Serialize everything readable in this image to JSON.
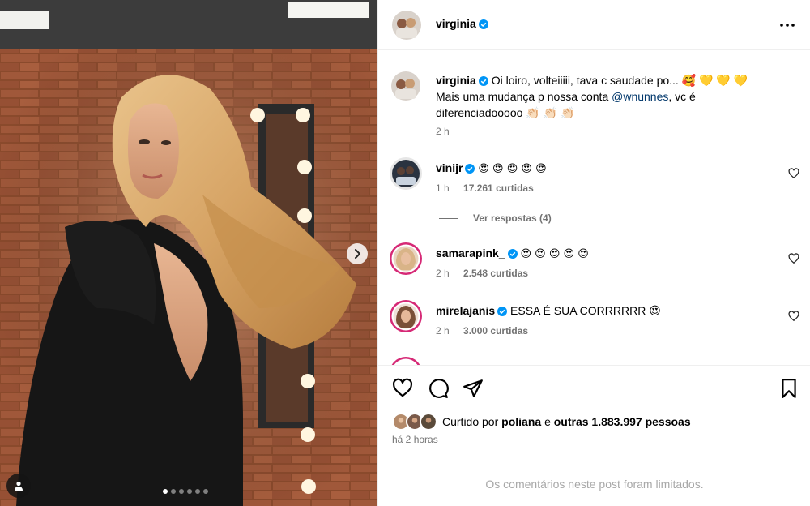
{
  "post": {
    "carousel": {
      "slide_count": 6,
      "active_index": 0
    }
  },
  "header": {
    "username": "virginia",
    "more_icon": "more-horizontal-icon"
  },
  "caption": {
    "username": "virginia",
    "text_line1": "Oi loiro, volteiiiii, tava c saudade po... 🥰 💛 💛 💛",
    "text_line2_prefix": "Mais uma mudança p nossa conta ",
    "mention": "@wnunnes",
    "text_line2_suffix": ", vc é",
    "text_line3": "diferenciadooooo 👏🏻 👏🏻 👏🏻",
    "time": "2 h"
  },
  "comments": [
    {
      "username": "vinijr",
      "text": "😍 😍 😍 😍 😍",
      "time": "1 h",
      "likes": "17.261 curtidas"
    },
    {
      "username": "samarapink_",
      "text": "😍 😍 😍 😍 😍",
      "time": "2 h",
      "likes": "2.548 curtidas"
    },
    {
      "username": "mirelajanis",
      "text": "ESSA É SUA CORRRRRR 😍",
      "time": "2 h",
      "likes": "3.000 curtidas"
    }
  ],
  "view_replies": "Ver respostas (4)",
  "liked_by": {
    "prefix": "Curtido por ",
    "user": "poliana",
    "middle": " e ",
    "others": "outras 1.883.997 pessoas"
  },
  "post_time": "há 2 horas",
  "comments_limited": "Os comentários neste post foram limitados.",
  "colors": {
    "verified": "#0095f6",
    "muted": "#737373",
    "mention": "#00376b",
    "border": "#efefef"
  }
}
